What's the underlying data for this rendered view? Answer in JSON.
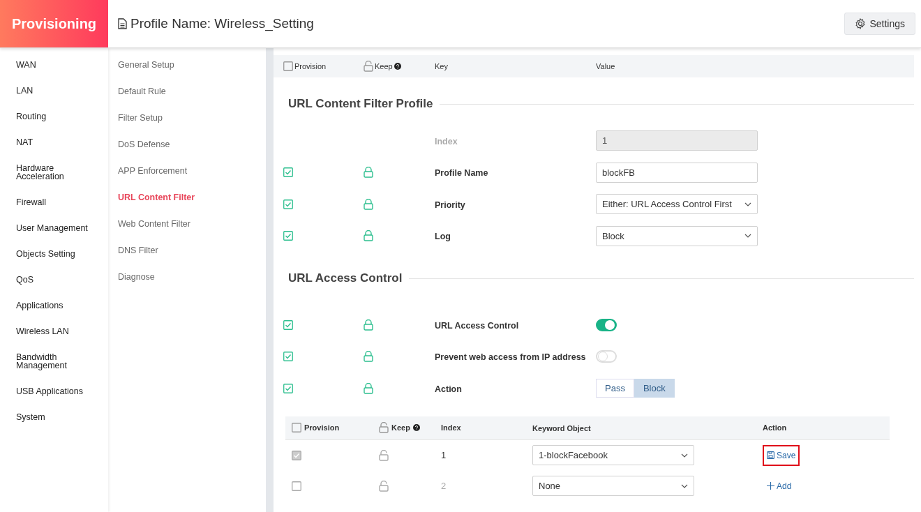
{
  "brand": "Provisioning",
  "page_title": "Profile Name: Wireless_Setting",
  "settings_button": "Settings",
  "nav": [
    {
      "label": "WAN"
    },
    {
      "label": "LAN"
    },
    {
      "label": "Routing"
    },
    {
      "label": "NAT"
    },
    {
      "label": "Hardware Acceleration"
    },
    {
      "label": "Firewall"
    },
    {
      "label": "User Management"
    },
    {
      "label": "Objects Setting"
    },
    {
      "label": "QoS"
    },
    {
      "label": "Applications"
    },
    {
      "label": "Wireless LAN"
    },
    {
      "label": "Bandwidth Management"
    },
    {
      "label": "USB Applications"
    },
    {
      "label": "System"
    }
  ],
  "subnav": [
    {
      "label": "General Setup",
      "selected": false
    },
    {
      "label": "Default Rule",
      "selected": false
    },
    {
      "label": "Filter Setup",
      "selected": false
    },
    {
      "label": "DoS Defense",
      "selected": false
    },
    {
      "label": "APP Enforcement",
      "selected": false
    },
    {
      "label": "URL Content Filter",
      "selected": true
    },
    {
      "label": "Web Content Filter",
      "selected": false
    },
    {
      "label": "DNS Filter",
      "selected": false
    },
    {
      "label": "Diagnose",
      "selected": false
    }
  ],
  "header": {
    "provision": "Provision",
    "provision_checked": false,
    "keep": "Keep",
    "key": "Key",
    "value": "Value"
  },
  "sections": [
    {
      "title": "URL Content Filter Profile",
      "rows": [
        {
          "kind": "readonly",
          "key": "Index",
          "value": "1"
        },
        {
          "kind": "text",
          "checked": true,
          "key": "Profile Name",
          "value": "blockFB"
        },
        {
          "kind": "select",
          "checked": true,
          "key": "Priority",
          "value": "Either: URL Access Control First"
        },
        {
          "kind": "select",
          "checked": true,
          "key": "Log",
          "value": "Block"
        }
      ]
    },
    {
      "title": "URL Access Control",
      "rows": [
        {
          "kind": "toggle",
          "checked": true,
          "key": "URL Access Control",
          "on": true
        },
        {
          "kind": "toggle",
          "checked": true,
          "key": "Prevent web access from IP address",
          "on": false
        },
        {
          "kind": "segmented",
          "checked": true,
          "key": "Action",
          "options": [
            {
              "label": "Pass",
              "selected": false
            },
            {
              "label": "Block",
              "selected": true
            }
          ]
        }
      ]
    }
  ],
  "table": {
    "columns": [
      "Provision",
      "Keep",
      "Index",
      "Keyword Object",
      "Action"
    ],
    "header_checked": false,
    "rows": [
      {
        "kind": "existing",
        "checked": true,
        "index": "1",
        "keyword": "1-blockFacebook",
        "action": "Save",
        "highlighted": true
      },
      {
        "kind": "new",
        "checked": false,
        "index": "2",
        "keyword": "None",
        "action": "Add",
        "highlighted": false
      }
    ]
  }
}
